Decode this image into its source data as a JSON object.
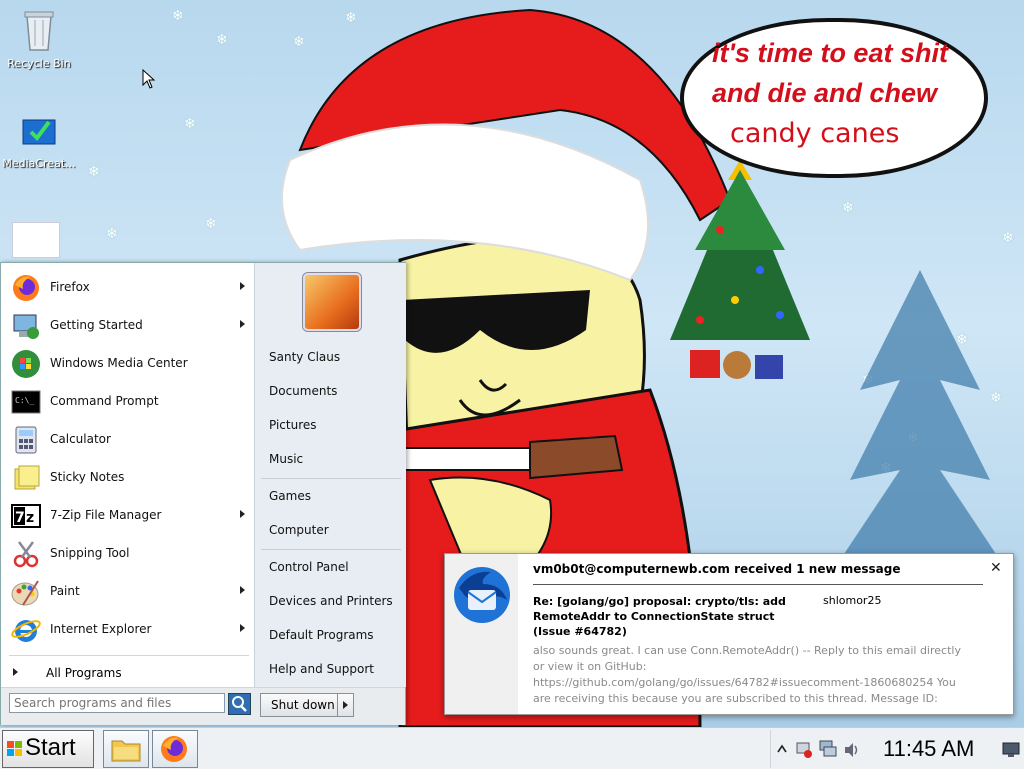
{
  "desktop": {
    "icons": [
      {
        "label": "Recycle Bin",
        "icon": "recycle-bin-icon"
      },
      {
        "label": "MediaCreat...",
        "icon": "media-creation-tool-icon"
      },
      {
        "label": "",
        "icon": "blank-file-icon"
      }
    ],
    "speech_bubble": {
      "line1": "it's time to eat shit",
      "line2": "and die and chew",
      "line3": "candy canes"
    }
  },
  "start_menu": {
    "programs": [
      {
        "label": "Firefox",
        "icon": "firefox-icon",
        "submenu": true
      },
      {
        "label": "Getting Started",
        "icon": "getting-started-icon",
        "submenu": true
      },
      {
        "label": "Windows Media Center",
        "icon": "windows-media-center-icon",
        "submenu": false
      },
      {
        "label": "Command Prompt",
        "icon": "command-prompt-icon",
        "submenu": false
      },
      {
        "label": "Calculator",
        "icon": "calculator-icon",
        "submenu": false
      },
      {
        "label": "Sticky Notes",
        "icon": "sticky-notes-icon",
        "submenu": false
      },
      {
        "label": "7-Zip File Manager",
        "icon": "7zip-icon",
        "submenu": true
      },
      {
        "label": "Snipping Tool",
        "icon": "snipping-tool-icon",
        "submenu": false
      },
      {
        "label": "Paint",
        "icon": "paint-icon",
        "submenu": true
      },
      {
        "label": "Internet Explorer",
        "icon": "internet-explorer-icon",
        "submenu": true
      }
    ],
    "all_programs": "All Programs",
    "search_placeholder": "Search programs and files",
    "shutdown_label": "Shut down",
    "right": {
      "user": "Santy Claus",
      "documents": "Documents",
      "pictures": "Pictures",
      "music": "Music",
      "games": "Games",
      "computer": "Computer",
      "control_panel": "Control Panel",
      "devices": "Devices and Printers",
      "default_programs": "Default Programs",
      "help": "Help and Support"
    }
  },
  "notification": {
    "title": "vm0b0t@computernewb.com received 1 new message",
    "subject": "Re: [golang/go] proposal: crypto/tls: add RemoteAddr to ConnectionState struct (Issue #64782)",
    "from": "shlomor25",
    "body": "also sounds great. I can use Conn.RemoteAddr() -- Reply to this email directly or view it on GitHub: https://github.com/golang/go/issues/64782#issuecomment-1860680254 You are receiving this because you are subscribed to this thread. Message ID:",
    "close": "✕",
    "icon": "thunderbird-icon"
  },
  "taskbar": {
    "start_label": "Start",
    "apps": [
      {
        "name": "File Explorer",
        "icon": "folder-icon"
      },
      {
        "name": "Firefox",
        "icon": "firefox-icon"
      }
    ],
    "clock": "11:45 AM",
    "tray_icons": [
      "show-hidden-icons",
      "action-center-icon",
      "network-icon",
      "volume-icon",
      "show-desktop-icon"
    ]
  }
}
